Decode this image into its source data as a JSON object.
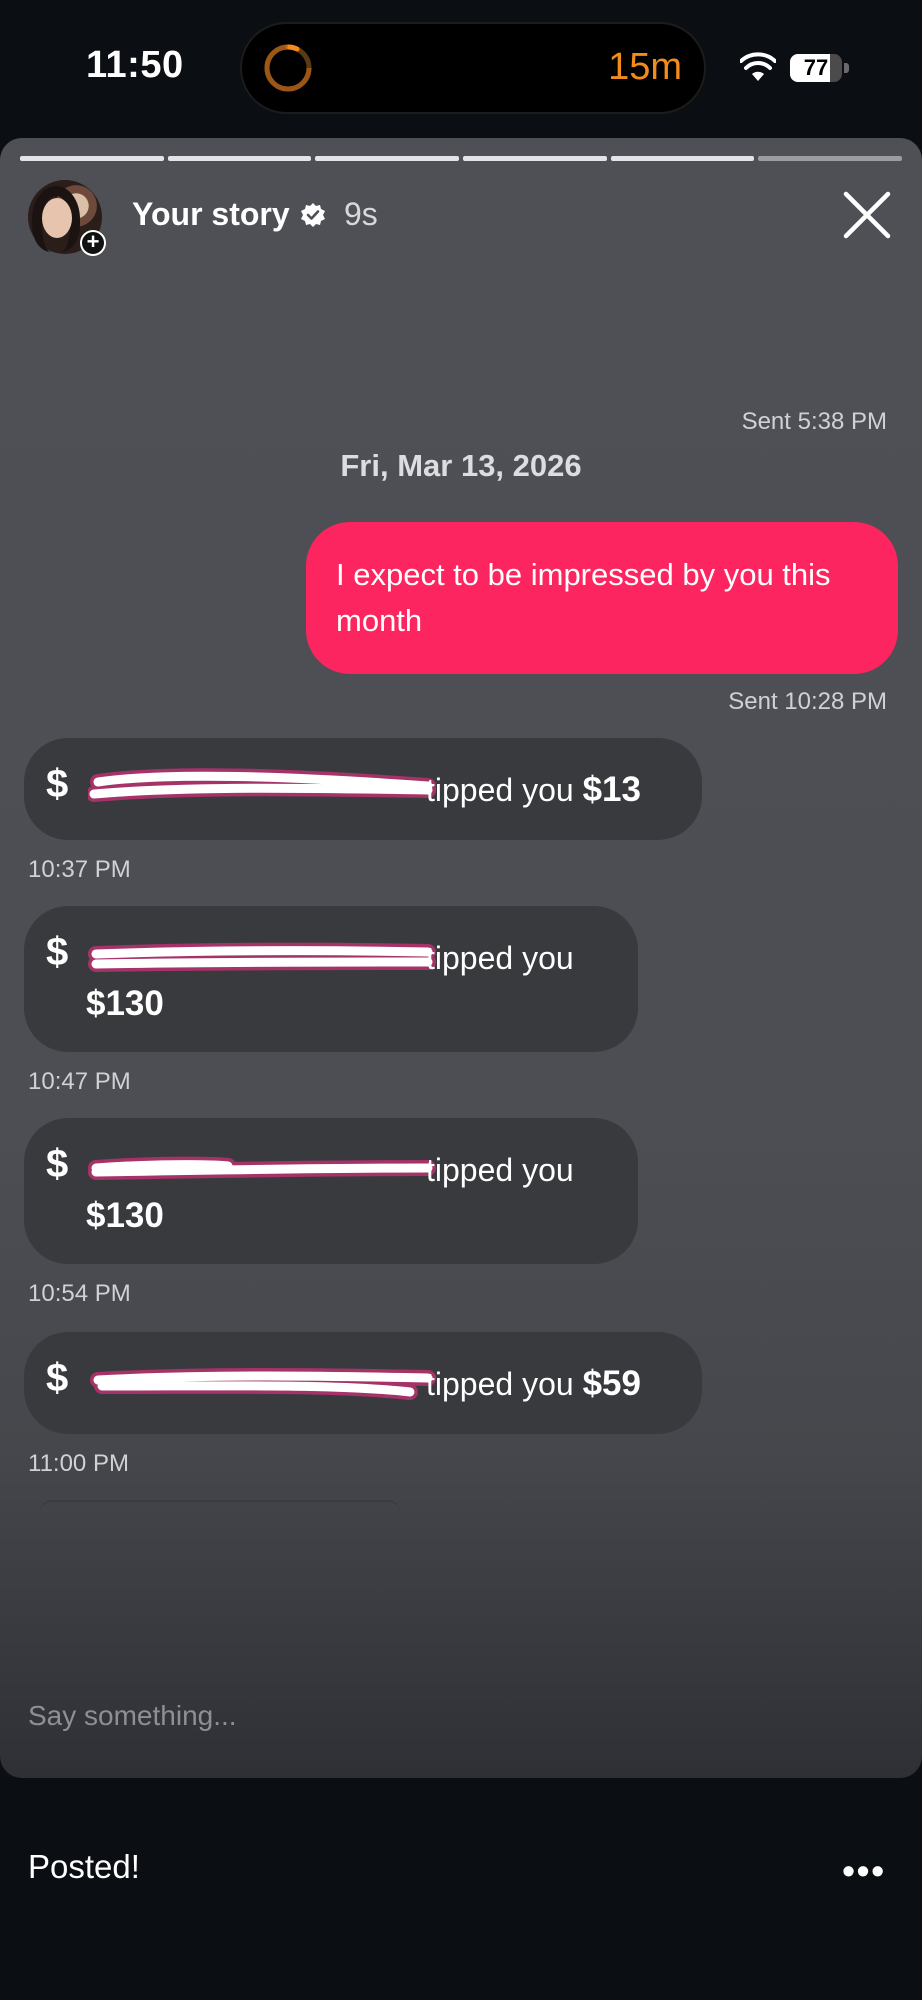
{
  "status_bar": {
    "time": "11:50",
    "activity_timer": "15m",
    "battery_level": "77",
    "battery_fraction": 0.77
  },
  "story": {
    "title": "Your story",
    "age": "9s",
    "progress_segments": 6
  },
  "chat": {
    "sent_first": "Sent 5:38 PM",
    "date": "Fri, Mar 13, 2026",
    "outgoing_message": "I expect to be impressed by you this month",
    "sent_second": "Sent 10:28 PM",
    "tips": [
      {
        "text": "tipped you",
        "amount": "$13",
        "time": "10:37 PM"
      },
      {
        "text": "tipped you",
        "amount": "$130",
        "time": "10:47 PM"
      },
      {
        "text": "tipped you",
        "amount": "$130",
        "time": "10:54 PM"
      },
      {
        "text": "tipped you",
        "amount": "$59",
        "time": "11:00 PM"
      }
    ],
    "currency_icon": "$"
  },
  "composer": {
    "placeholder": "Say something..."
  },
  "footer": {
    "status": "Posted!",
    "more_icon": "•••"
  },
  "colors": {
    "accent_pink": "#fc2560",
    "timer_orange": "#f28c1b",
    "tip_bubble": "#393a3e",
    "scribble": "#ff2d8a"
  }
}
